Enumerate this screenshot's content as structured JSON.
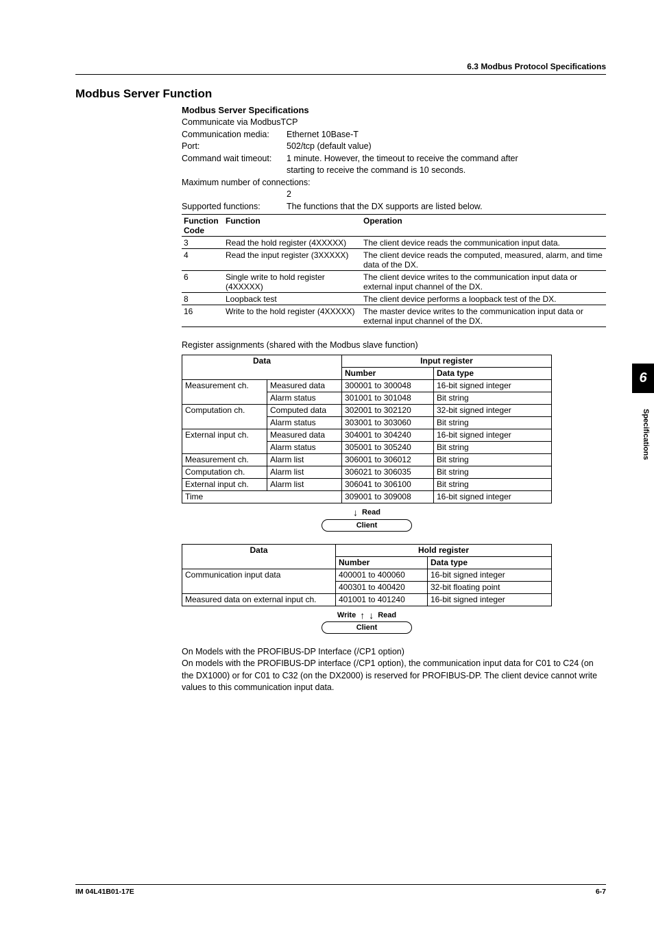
{
  "header": {
    "section": "6.3  Modbus Protocol Specifications"
  },
  "headings": {
    "main": "Modbus Server Function",
    "sub": "Modbus Server Specifications"
  },
  "intro": "Communicate via ModbusTCP",
  "specs": {
    "comm_media_label": "Communication media:",
    "comm_media_value": "Ethernet 10Base-T",
    "port_label": "Port:",
    "port_value": "502/tcp (default value)",
    "cmd_wait_label": "Command wait timeout:",
    "cmd_wait_value1": "1 minute.  However, the timeout to receive the command after",
    "cmd_wait_value2": "starting to receive the command is 10 seconds.",
    "max_conn_label": "Maximum number of connections:",
    "max_conn_value": "2",
    "supported_label": "Supported functions:",
    "supported_value": "The functions that the DX supports are listed below."
  },
  "func_table": {
    "h_code": "Function Code",
    "h_func": "Function",
    "h_op": "Operation",
    "rows": [
      {
        "code": "3",
        "func": "Read the hold register (4XXXXX)",
        "op": "The client device reads the communication input data."
      },
      {
        "code": "4",
        "func": "Read the input register (3XXXXX)",
        "op": "The client device reads the computed, measured, alarm, and time data of the DX."
      },
      {
        "code": "6",
        "func": "Single write to hold register (4XXXXX)",
        "op": "The client device writes to the communication input data or external input channel of the DX."
      },
      {
        "code": "8",
        "func": "Loopback test",
        "op": "The client device performs a loopback test of the DX."
      },
      {
        "code": "16",
        "func": "Write to the hold register (4XXXXX)",
        "op": "The master device writes to the communication input data or external input channel of the DX."
      }
    ]
  },
  "reg_assign_text": "Register assignments (shared with the Modbus slave function)",
  "reg_table": {
    "h_data": "Data",
    "h_input": "Input register",
    "h_number": "Number",
    "h_type": "Data type",
    "rows": [
      {
        "cat": "Measurement ch.",
        "sub": "Measured data",
        "num": "300001 to 300048",
        "type": "16-bit signed integer"
      },
      {
        "cat": "",
        "sub": "Alarm status",
        "num": "301001 to 301048",
        "type": "Bit string"
      },
      {
        "cat": "Computation ch.",
        "sub": "Computed data",
        "num": "302001 to 302120",
        "type": "32-bit signed integer"
      },
      {
        "cat": "",
        "sub": "Alarm status",
        "num": "303001 to 303060",
        "type": "Bit string"
      },
      {
        "cat": "External input ch.",
        "sub": "Measured data",
        "num": "304001 to 304240",
        "type": "16-bit signed integer"
      },
      {
        "cat": "",
        "sub": "Alarm status",
        "num": "305001 to 305240",
        "type": "Bit string"
      },
      {
        "cat": "Measurement ch.",
        "sub": "Alarm list",
        "num": "306001 to 306012",
        "type": "Bit string"
      },
      {
        "cat": "Computation ch.",
        "sub": "Alarm list",
        "num": "306021 to 306035",
        "type": "Bit string"
      },
      {
        "cat": "External input ch.",
        "sub": "Alarm list",
        "num": "306041 to 306100",
        "type": "Bit string"
      },
      {
        "cat": "Time",
        "sub": "",
        "num": "309001 to 309008",
        "type": "16-bit signed integer",
        "colspan": true
      }
    ]
  },
  "labels": {
    "read": "Read",
    "write": "Write",
    "client": "Client"
  },
  "hold_table": {
    "h_data": "Data",
    "h_hold": "Hold register",
    "h_number": "Number",
    "h_type": "Data type",
    "rows": [
      {
        "data": "Communication input data",
        "num": "400001 to 400060",
        "type": "16-bit signed integer",
        "rowspan": true
      },
      {
        "data": "",
        "num": "400301 to 400420",
        "type": "32-bit floating point"
      },
      {
        "data": "Measured data on external input ch.",
        "num": "401001 to 401240",
        "type": "16-bit signed integer"
      }
    ]
  },
  "profibus": {
    "heading": "On Models with the PROFIBUS-DP Interface (/CP1 option)",
    "body": "On models with the PROFIBUS-DP interface (/CP1 option), the communication input data for C01 to C24 (on the DX1000) or for C01 to C32 (on the DX2000) is reserved for PROFIBUS-DP. The client device cannot write values to this communication input data."
  },
  "sidetab": {
    "num": "6",
    "label": "Specifications"
  },
  "footer": {
    "left": "IM 04L41B01-17E",
    "right": "6-7"
  }
}
